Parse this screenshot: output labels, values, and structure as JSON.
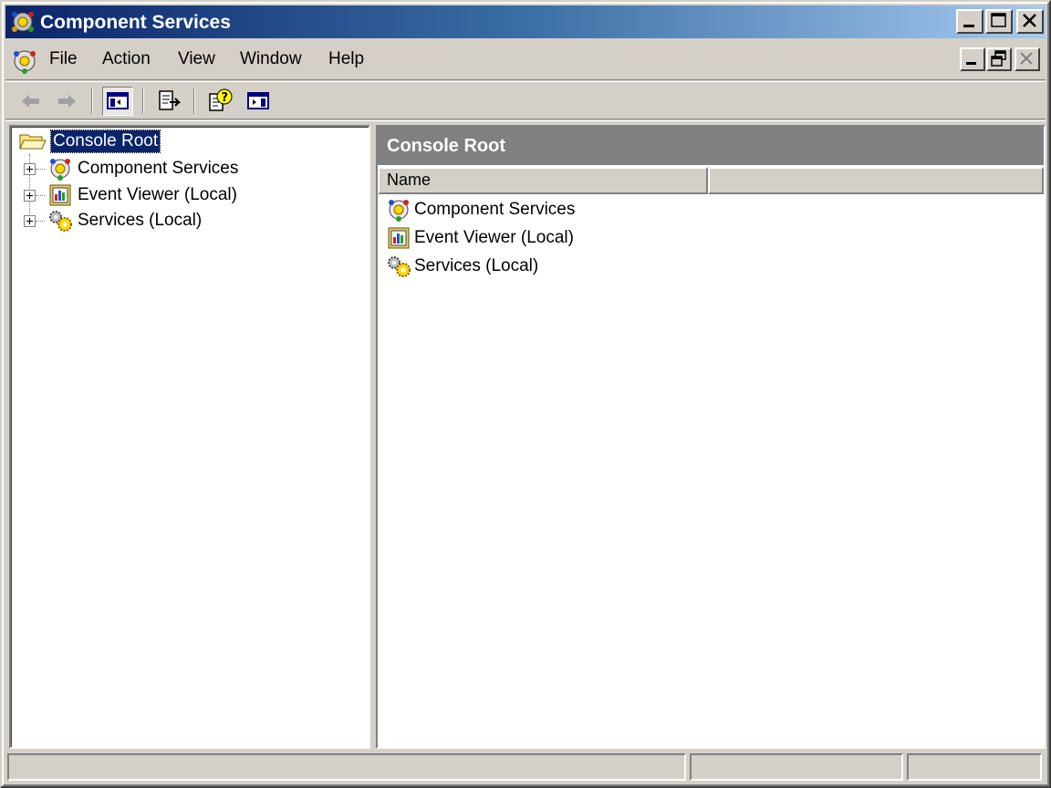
{
  "window": {
    "title": "Component Services"
  },
  "menu": {
    "items": [
      "File",
      "Action",
      "View",
      "Window",
      "Help"
    ]
  },
  "toolbar": {
    "buttons": [
      "back-arrow-icon",
      "forward-arrow-icon",
      "show-hide-tree-icon",
      "export-list-icon",
      "help-icon",
      "show-hide-action-pane-icon"
    ]
  },
  "tree": {
    "root_label": "Console Root",
    "items": [
      {
        "label": "Component Services",
        "icon": "component-services-icon"
      },
      {
        "label": "Event Viewer (Local)",
        "icon": "event-viewer-icon"
      },
      {
        "label": "Services (Local)",
        "icon": "services-gears-icon"
      }
    ]
  },
  "right_pane": {
    "header": "Console Root",
    "columns": [
      "Name",
      ""
    ],
    "items": [
      {
        "label": "Component Services",
        "icon": "component-services-icon"
      },
      {
        "label": "Event Viewer (Local)",
        "icon": "event-viewer-icon"
      },
      {
        "label": "Services (Local)",
        "icon": "services-gears-icon"
      }
    ]
  },
  "colors": {
    "title_gradient_start": "#0a246a",
    "title_gradient_end": "#a6caf0",
    "face": "#d4d0c8",
    "selection": "#0a246a",
    "pane_header": "#808080"
  }
}
